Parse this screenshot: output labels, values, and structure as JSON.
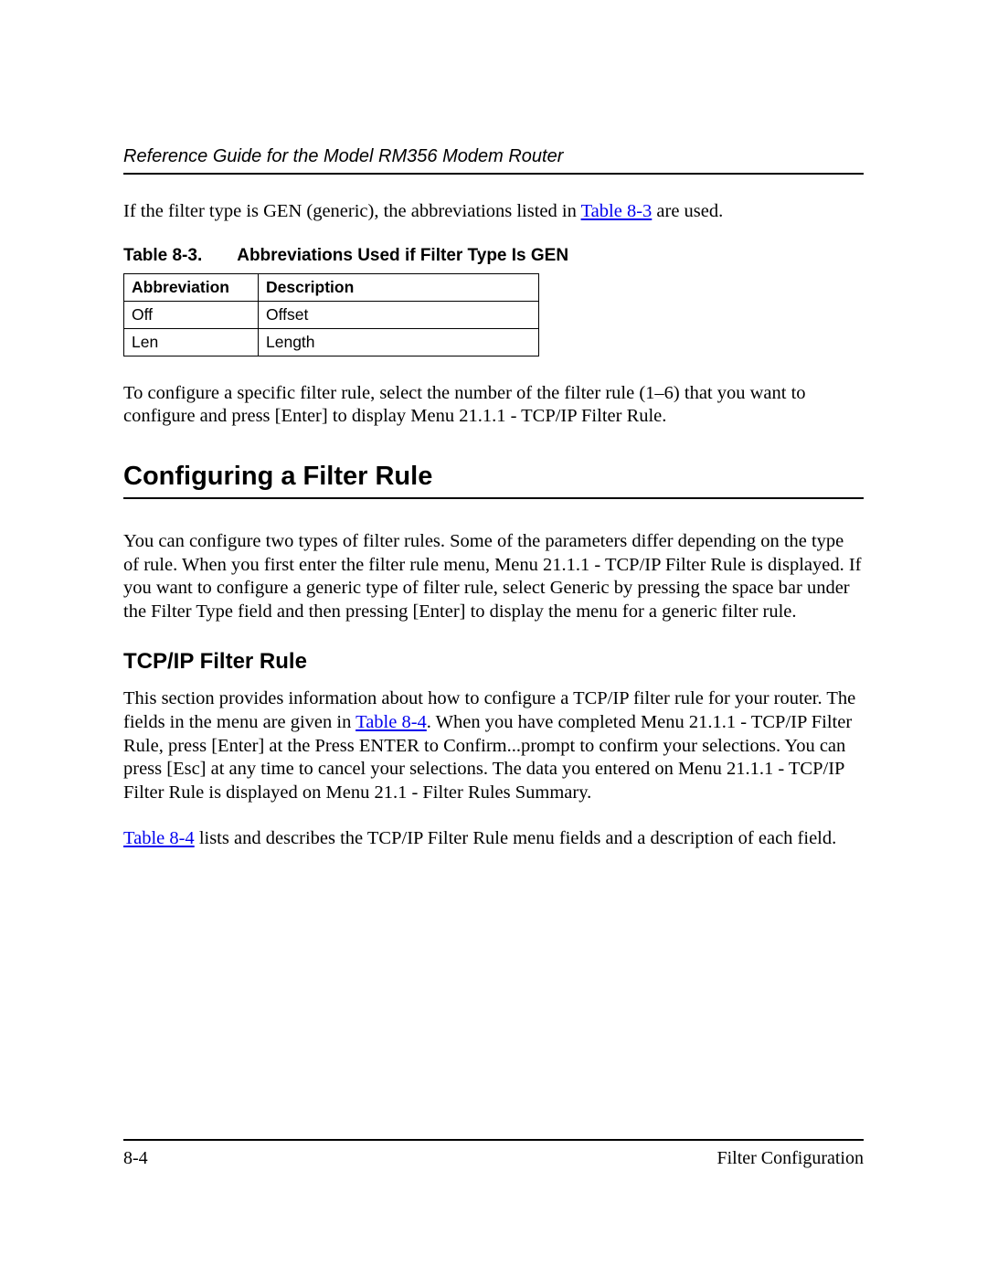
{
  "header": {
    "doc_title": "Reference Guide for the Model RM356 Modem Router"
  },
  "intro": {
    "para1_pre": "If the filter type is GEN (generic), the abbreviations listed in ",
    "para1_link": "Table 8-3",
    "para1_post": " are used."
  },
  "table83": {
    "caption_num": "Table 8-3.",
    "caption_title": "Abbreviations Used if Filter Type Is GEN",
    "headers": {
      "abbr": "Abbreviation",
      "desc": "Description"
    },
    "rows": [
      {
        "abbr": "Off",
        "desc": "Offset"
      },
      {
        "abbr": "Len",
        "desc": "Length"
      }
    ]
  },
  "para2": "To configure a specific filter rule, select the number of the filter rule (1–6) that you want to configure and press [Enter] to display Menu 21.1.1 - TCP/IP Filter Rule.",
  "section": {
    "heading": "Configuring a Filter Rule",
    "para": "You can configure two types of filter rules. Some of the parameters differ depending on the type of rule. When you first enter the filter rule menu, Menu 21.1.1 - TCP/IP Filter Rule is displayed. If you want to configure a generic type of filter rule, select Generic by pressing the space bar under the Filter Type field and then pressing [Enter] to display the menu for a generic filter rule."
  },
  "subsection": {
    "heading": "TCP/IP Filter Rule",
    "para1_pre": "This section provides information about how to configure a TCP/IP filter rule for your router. The fields in the menu are given in ",
    "para1_link": "Table 8-4",
    "para1_post": ". When you have completed Menu 21.1.1 - TCP/IP Filter Rule, press [Enter] at the Press ENTER to Confirm...prompt to confirm your selections. You can press [Esc] at any time to cancel your selections. The data you entered on Menu 21.1.1 - TCP/IP Filter Rule is displayed on Menu 21.1 - Filter Rules Summary.",
    "para2_link": "Table 8-4",
    "para2_post": " lists and describes the TCP/IP Filter Rule menu fields and a description of each field."
  },
  "footer": {
    "page_num": "8-4",
    "section_name": "Filter Configuration"
  }
}
